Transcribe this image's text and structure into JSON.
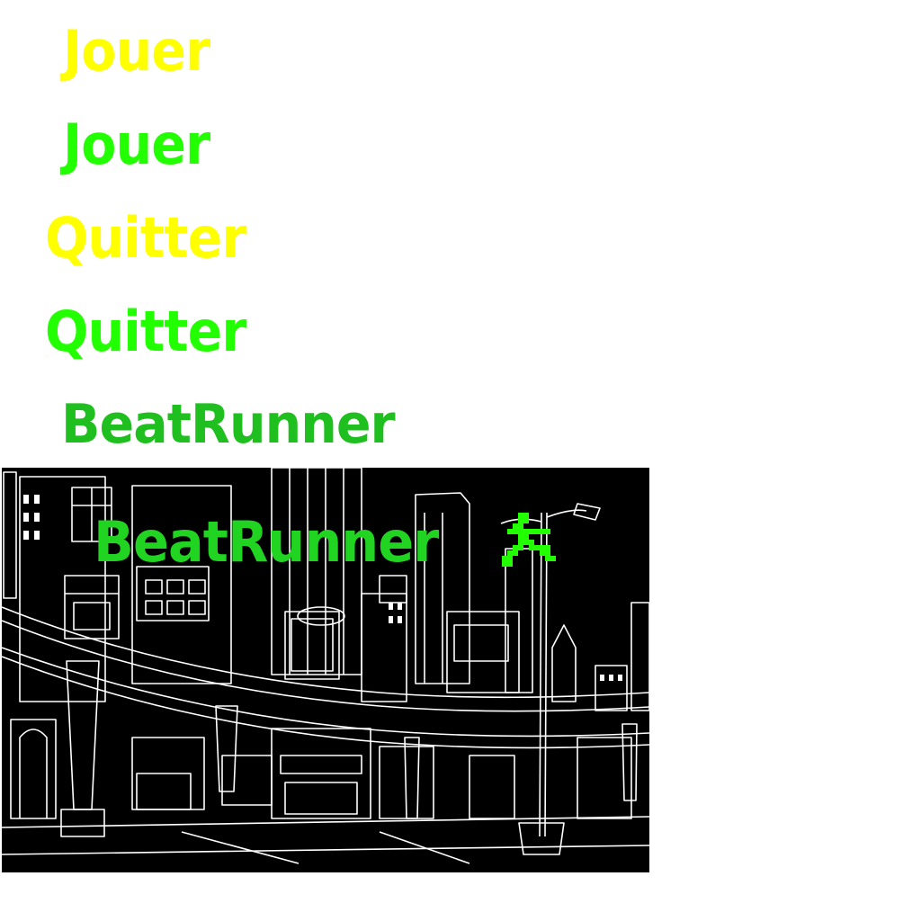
{
  "sprites": {
    "play_yellow": "Jouer",
    "play_green": "Jouer",
    "quit_yellow": "Quitter",
    "quit_green": "Quitter",
    "logo": "BeatRunner"
  },
  "title_screen": {
    "logo": "BeatRunner",
    "background_image": "city-street-line-art",
    "icon": "runner-icon"
  },
  "colors": {
    "yellow": "#ffff00",
    "bright_green": "#22ff00",
    "logo_green": "#1fbf1f",
    "logo_overlay_green": "#22d422",
    "background": "#000000",
    "lines": "#ffffff"
  }
}
